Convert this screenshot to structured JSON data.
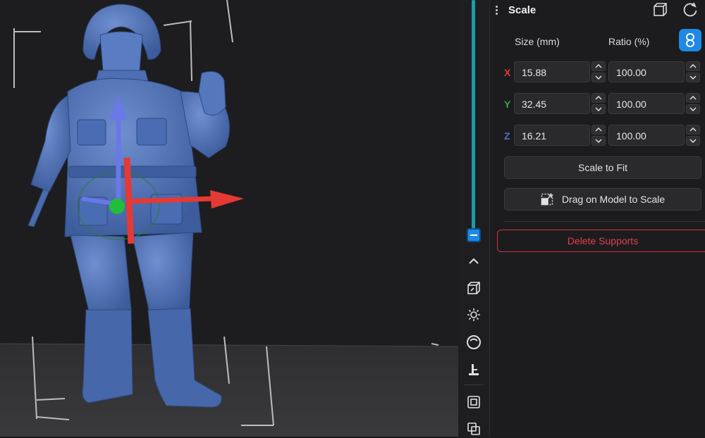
{
  "panel": {
    "title": "Scale",
    "icons": [
      "bounding-box-icon",
      "reset-icon",
      "link-icon"
    ],
    "size_label": "Size (mm)",
    "ratio_label": "Ratio (%)",
    "uniform_scale_locked": true,
    "rows": [
      {
        "axis": "X",
        "size": "15.88",
        "ratio": "100.00",
        "color": "#e53935"
      },
      {
        "axis": "Y",
        "size": "32.45",
        "ratio": "100.00",
        "color": "#43a047"
      },
      {
        "axis": "Z",
        "size": "16.21",
        "ratio": "100.00",
        "color": "#5c6bc0"
      }
    ],
    "scale_to_fit_label": "Scale to Fit",
    "drag_scale_label": "Drag on Model to Scale",
    "delete_supports_label": "Delete Supports"
  },
  "toolbar": {
    "icons": [
      "collapse-up-icon",
      "cube-icon",
      "orbit-icon",
      "sphere-icon",
      "support-icon",
      "frame-icon",
      "overlap-icon"
    ]
  },
  "layer_slider": {
    "level": 1.0
  },
  "colors": {
    "accent": "#1e88e5",
    "slider": "#1f9aa6",
    "model": "#4a6fb5",
    "danger": "#e2404c"
  }
}
